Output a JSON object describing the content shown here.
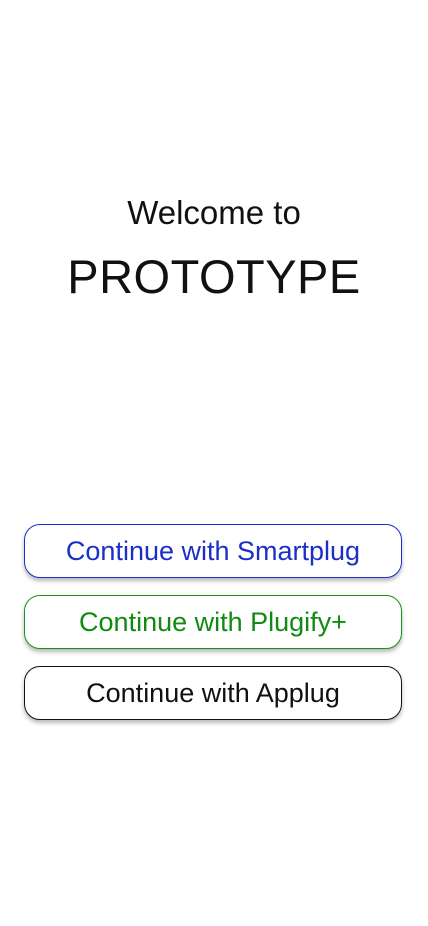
{
  "welcome": {
    "line": "Welcome to",
    "app_name": "PROTOTYPE"
  },
  "buttons": [
    {
      "label": "Continue with Smartplug",
      "color": "#1a2fc8"
    },
    {
      "label": "Continue with Plugify+",
      "color": "#128a12"
    },
    {
      "label": "Continue with Applug",
      "color": "#111111"
    }
  ]
}
